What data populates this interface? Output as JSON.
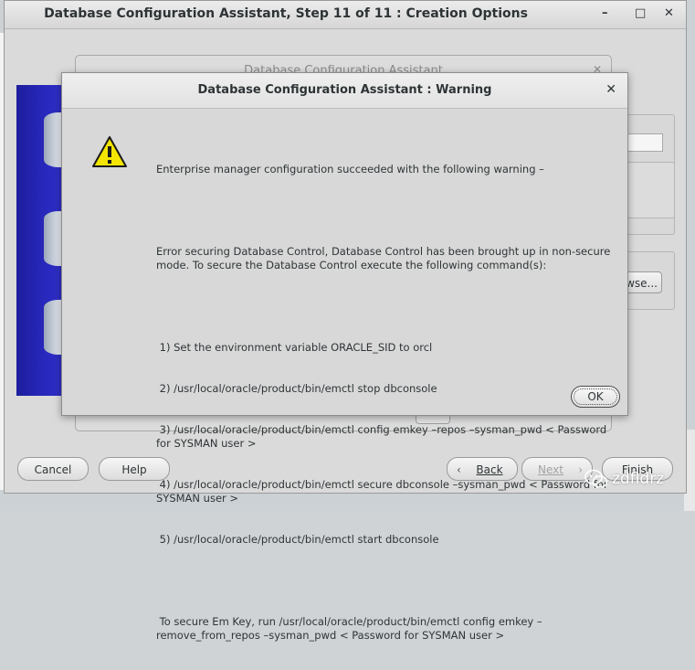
{
  "main_window": {
    "title": "Database Configuration Assistant, Step 11 of 11 : Creation Options",
    "controls": {
      "minimize": "–",
      "maximize": "□",
      "close": "✕"
    },
    "buttons": {
      "cancel": "Cancel",
      "help": "Help",
      "back": "Back",
      "next": "Next",
      "finish": "Finish"
    },
    "browse_fragment": "wse..."
  },
  "behind_dialog": {
    "title": "Database Configuration Assistant",
    "close": "✕"
  },
  "warning_dialog": {
    "title": "Database Configuration Assistant : Warning",
    "close": "✕",
    "lines": [
      "Enterprise manager configuration succeeded with the following warning –",
      "",
      "Error securing Database Control, Database Control has been brought up in non-secure mode. To secure the Database Control execute the following command(s):",
      "",
      " 1) Set the environment variable ORACLE_SID to orcl",
      " 2) /usr/local/oracle/product/bin/emctl stop dbconsole",
      " 3) /usr/local/oracle/product/bin/emctl config emkey –repos –sysman_pwd < Password for SYSMAN user >",
      " 4) /usr/local/oracle/product/bin/emctl secure dbconsole –sysman_pwd < Password for SYSMAN user >",
      " 5) /usr/local/oracle/product/bin/emctl start dbconsole",
      "",
      " To secure Em Key, run /usr/local/oracle/product/bin/emctl config emkey –remove_from_repos –sysman_pwd < Password for SYSMAN user >"
    ],
    "ok_label": "OK",
    "icon": "warning-icon"
  },
  "watermark": {
    "text": "zdfldrz"
  },
  "colors": {
    "warning_yellow": "#f5e600",
    "sidebar_blue": "#2a2ac2"
  }
}
